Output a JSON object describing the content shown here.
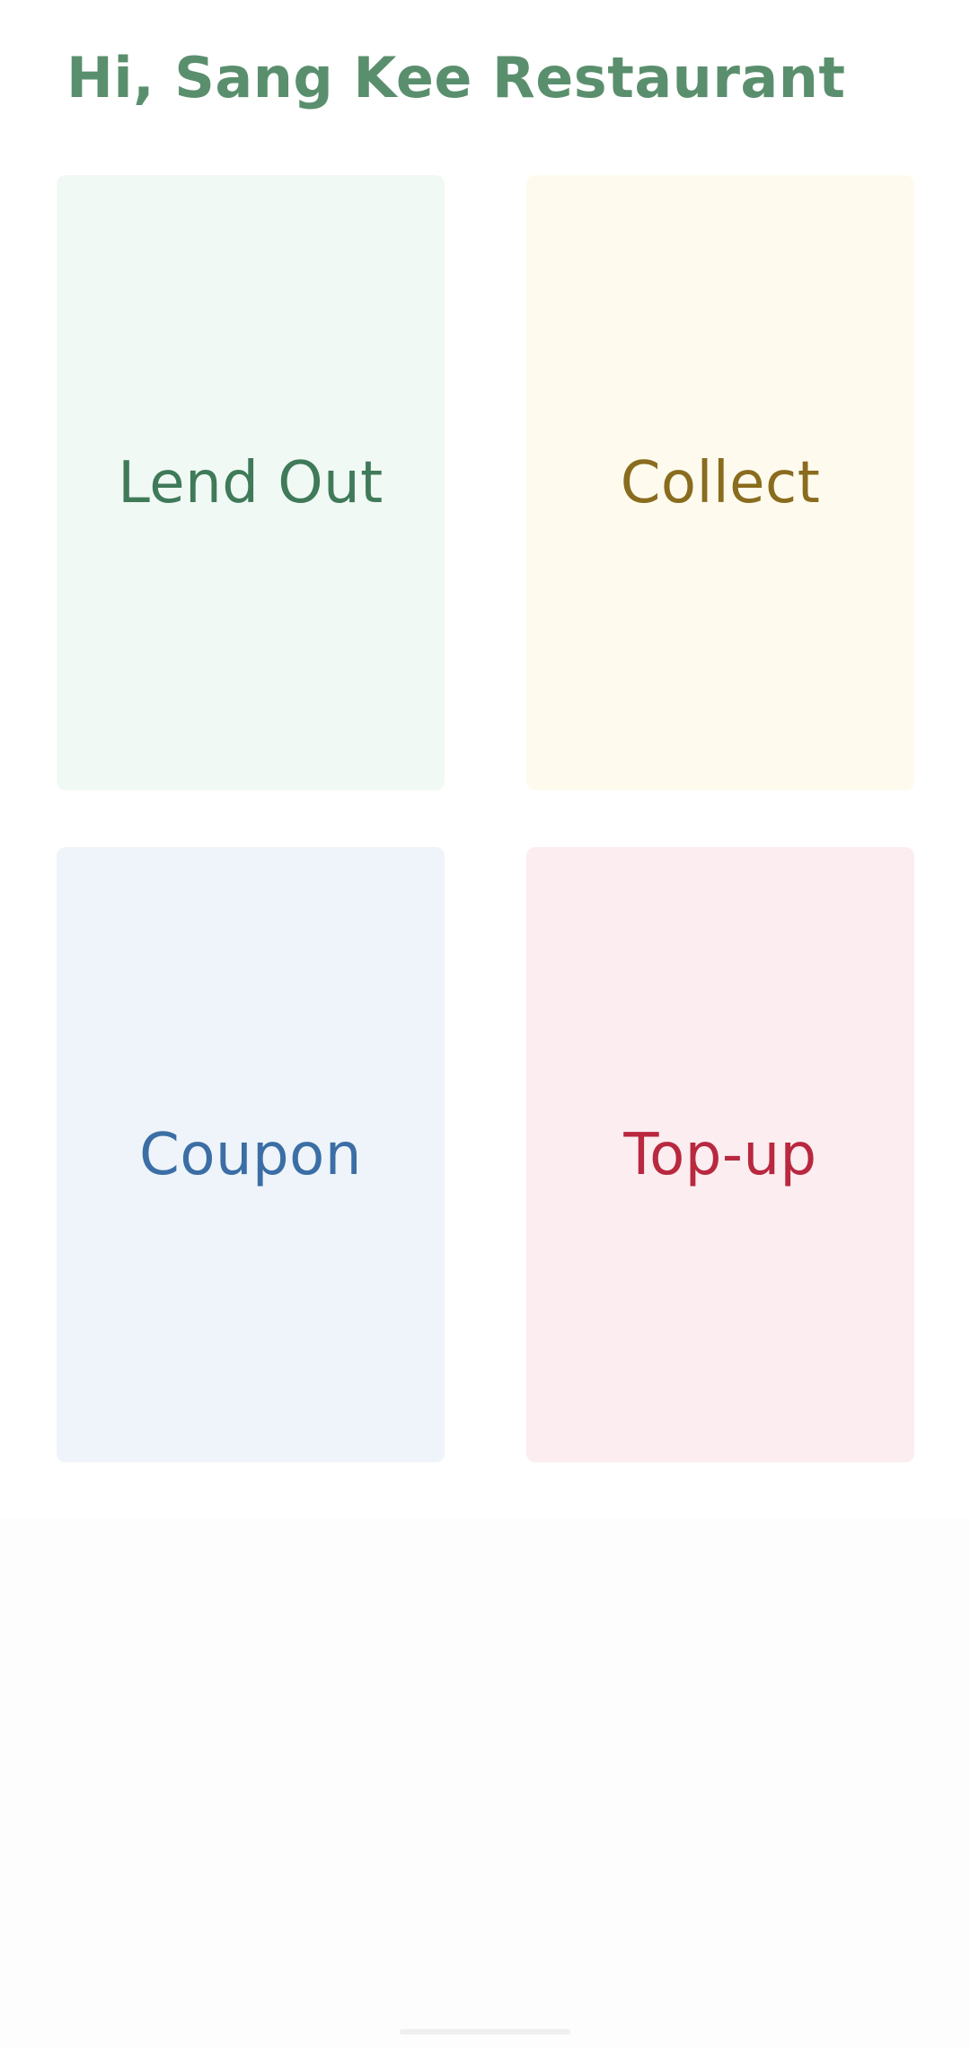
{
  "header": {
    "greeting": "Hi, Sang Kee Restaurant",
    "color": "#5a8f6e"
  },
  "tiles": [
    {
      "label": "Lend Out",
      "bg": "#f1f9f4",
      "fg": "#3f7a59"
    },
    {
      "label": "Collect",
      "bg": "#fefbee",
      "fg": "#8a6c1f"
    },
    {
      "label": "Coupon",
      "bg": "#eef4f9",
      "fg": "#3b6ea5"
    },
    {
      "label": "Top-up",
      "bg": "#fbedf0",
      "fg": "#b8283f"
    }
  ]
}
